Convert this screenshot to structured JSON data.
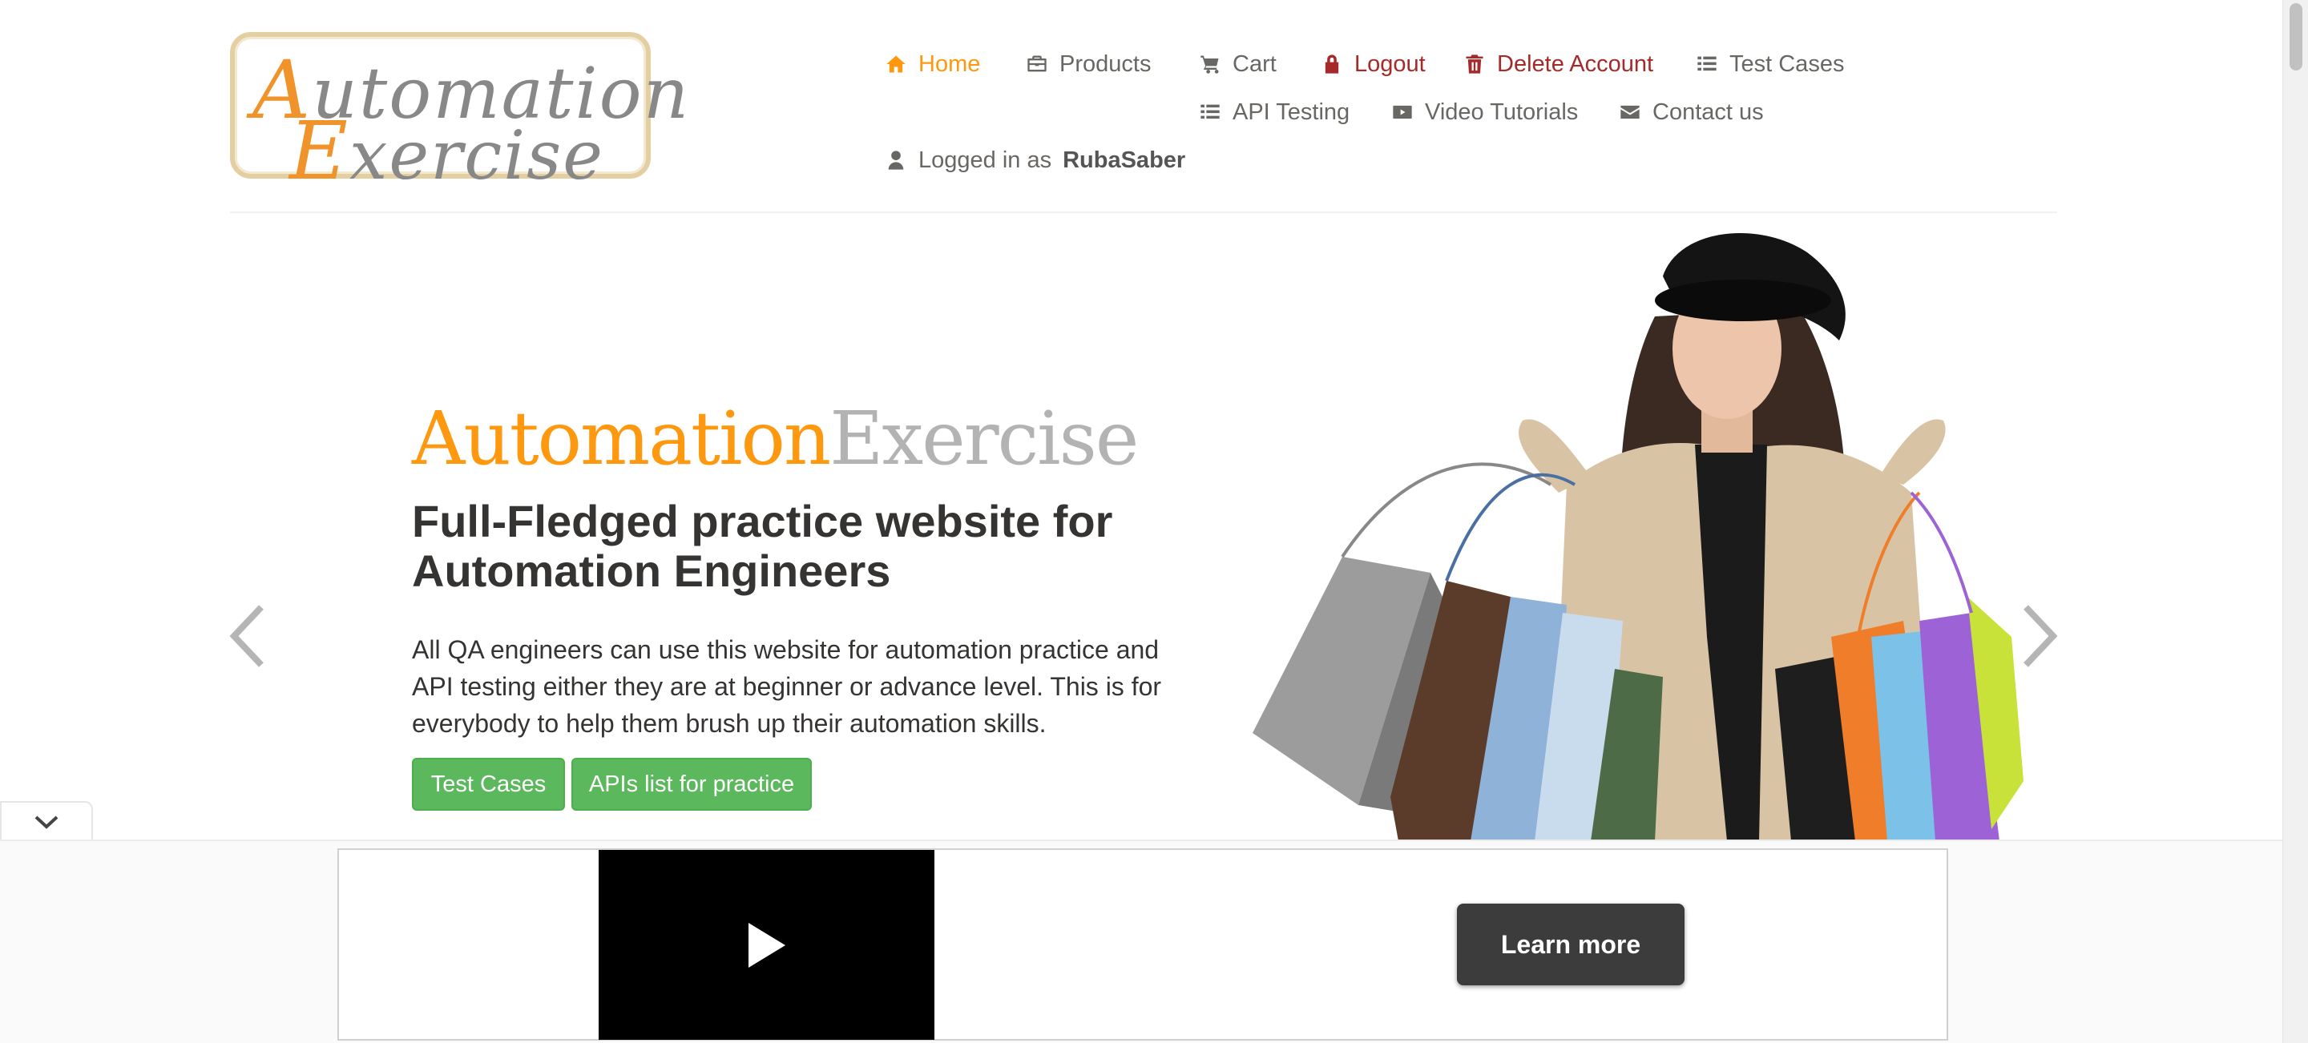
{
  "logo": {
    "line1": "Automation",
    "line2": "Exercise"
  },
  "nav": {
    "home": "Home",
    "products": "Products",
    "cart": "Cart",
    "logout": "Logout",
    "delete_account": "Delete Account",
    "test_cases": "Test Cases",
    "api_testing": "API Testing",
    "video_tutorials": "Video Tutorials",
    "contact_us": "Contact us",
    "logged_in_prefix": "Logged in as",
    "username": "RubaSaber"
  },
  "slider": {
    "brand_part1": "Automation",
    "brand_part2": "Exercise",
    "headline": "Full-Fledged practice website for Automation Engineers",
    "description": "All QA engineers can use this website for automation practice and API testing either they are at beginner or advance level. This is for everybody to help them brush up their automation skills.",
    "btn_test_cases": "Test Cases",
    "btn_apis": "APIs list for practice"
  },
  "ad": {
    "learn_more": "Learn more"
  },
  "colors": {
    "accent": "#fe980f",
    "danger": "#a52a2a",
    "button_green": "#5cb85c",
    "text": "#696763"
  },
  "icons": [
    "home-icon",
    "briefcase-icon",
    "cart-icon",
    "lock-icon",
    "trash-icon",
    "list-icon",
    "youtube-icon",
    "envelope-icon",
    "user-icon"
  ]
}
